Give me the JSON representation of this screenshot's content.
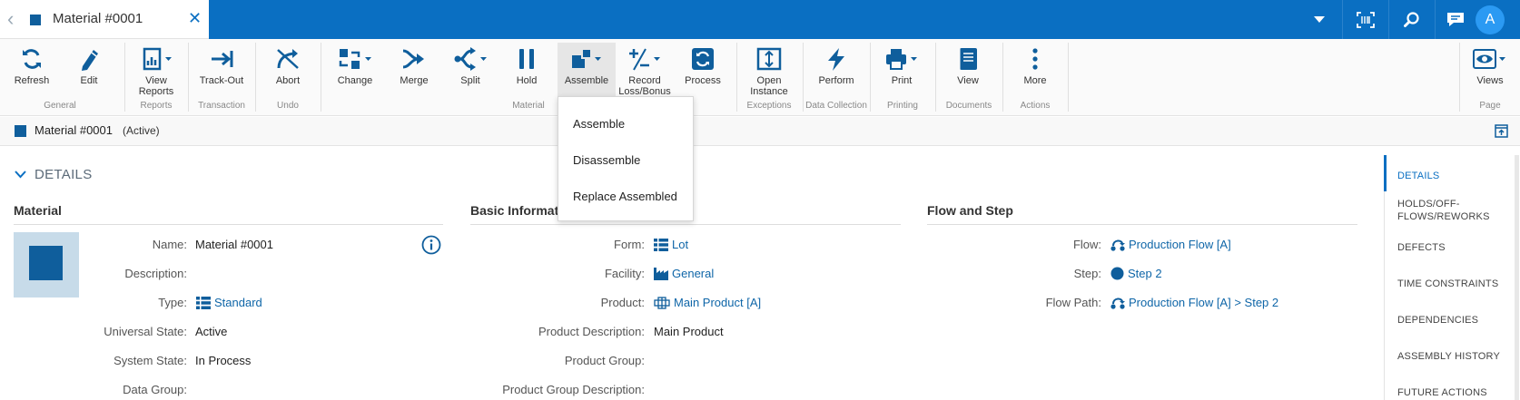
{
  "topbar": {
    "tab_title": "Material #0001",
    "avatar_initial": "A"
  },
  "ribbon": {
    "buttons": [
      {
        "label": "Refresh"
      },
      {
        "label": "Edit"
      },
      {
        "label": "View\nReports"
      },
      {
        "label": "Track-Out"
      },
      {
        "label": "Abort"
      },
      {
        "label": "Change"
      },
      {
        "label": "Merge"
      },
      {
        "label": "Split"
      },
      {
        "label": "Hold"
      },
      {
        "label": "Assemble"
      },
      {
        "label": "Record\nLoss/Bonus"
      },
      {
        "label": "Process"
      },
      {
        "label": "Open\nInstance"
      },
      {
        "label": "Perform"
      },
      {
        "label": "Print"
      },
      {
        "label": "View"
      },
      {
        "label": "More"
      },
      {
        "label": "Views"
      }
    ],
    "groups": [
      "General",
      "Reports",
      "Transaction",
      "Undo",
      "Material",
      "Exceptions",
      "Data Collection",
      "Printing",
      "Documents",
      "Actions",
      "Page"
    ]
  },
  "header": {
    "name": "Material #0001",
    "state": "(Active)"
  },
  "details": {
    "title": "DETAILS",
    "material": {
      "title": "Material",
      "labels": [
        "Name:",
        "Description:",
        "Type:",
        "Universal State:",
        "System State:",
        "Data Group:"
      ],
      "name": "Material #0001",
      "type": "Standard",
      "universal_state": "Active",
      "system_state": "In Process"
    },
    "basic": {
      "title": "Basic Informat",
      "labels": [
        "Form:",
        "Facility:",
        "Product:",
        "Product Description:",
        "Product Group:",
        "Product Group Description:"
      ],
      "form": "Lot",
      "facility": "General",
      "product": "Main Product [A]",
      "product_description": "Main Product"
    },
    "flow": {
      "title": "Flow and Step",
      "labels": [
        "Flow:",
        "Step:",
        "Flow Path:"
      ],
      "flow": "Production Flow [A]",
      "step": "Step 2",
      "flow_path": "Production Flow [A] > Step 2"
    }
  },
  "rnav": {
    "items": [
      "DETAILS",
      "HOLDS/OFF-\nFLOWS/REWORKS",
      "DEFECTS",
      "TIME CONSTRAINTS",
      "DEPENDENCIES",
      "ASSEMBLY HISTORY",
      "FUTURE ACTIONS"
    ]
  },
  "dropdown": {
    "items": [
      "Assemble",
      "Disassemble",
      "Replace Assembled"
    ]
  },
  "colors": {
    "brand": "#0a6fc2",
    "link": "#0f66a8",
    "icon": "#0f5e9c"
  }
}
